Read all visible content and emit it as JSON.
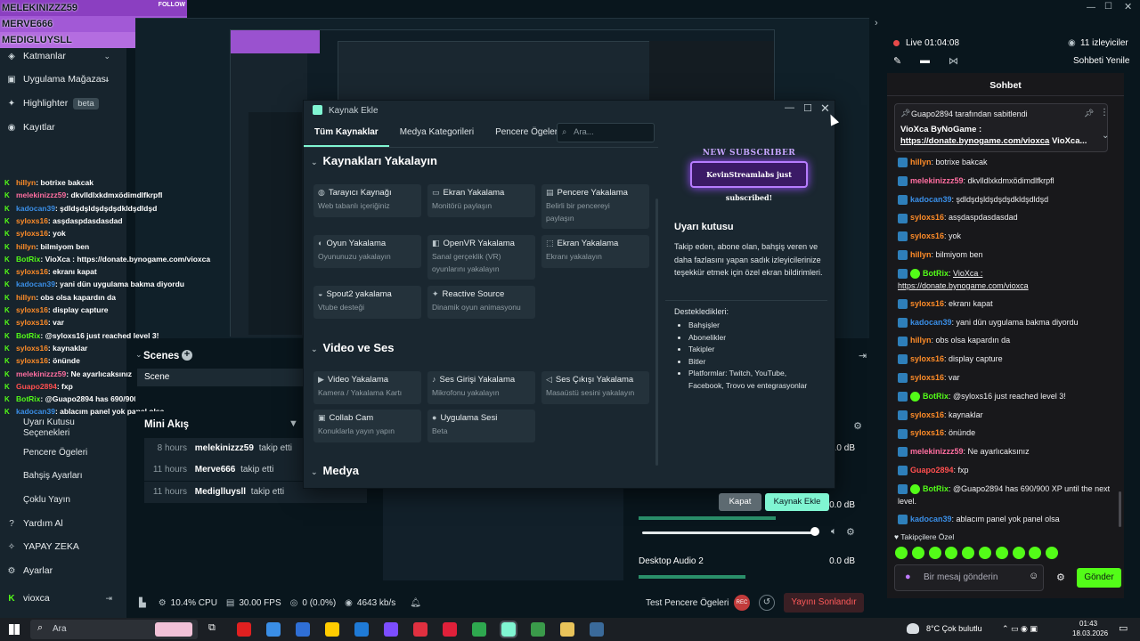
{
  "top_overlay": {
    "names": [
      "MELEKINIZZZ59",
      "MERVE666",
      "MEDIGLUYSLL"
    ],
    "follow": "FOLLOW"
  },
  "sidebar": {
    "items": [
      {
        "label": "Katmanlar",
        "chevron": true
      },
      {
        "label": "Uygulama Mağazası",
        "chevron": true
      },
      {
        "label": "Highlighter",
        "badge": "beta"
      },
      {
        "label": "Kayıtlar"
      }
    ],
    "sub_items": [
      "Uyarı Kutusu Seçenekleri",
      "Pencere Ögeleri",
      "Bahşiş Ayarları",
      "Çoklu Yayın"
    ],
    "bottom": [
      {
        "label": "Yardım Al"
      },
      {
        "label": "YAPAY ZEKA"
      },
      {
        "label": "Ayarlar"
      }
    ],
    "user": "vioxca"
  },
  "overlay_chat": [
    {
      "user": "hillyn",
      "color": "#ff8c28",
      "text": "botrixe bakcak"
    },
    {
      "user": "melekinizzz59",
      "color": "#ff6ea0",
      "text": "dkvlldlxkdmxödimdlfkrpfl"
    },
    {
      "user": "kadocan39",
      "color": "#3a8ee6",
      "text": "şdldşdşldşdşdşdkldşdldşd"
    },
    {
      "user": "syloxs16",
      "color": "#ff8c28",
      "text": "asşdaspdasdasdad"
    },
    {
      "user": "syloxs16",
      "color": "#ff8c28",
      "text": "yok"
    },
    {
      "user": "hillyn",
      "color": "#ff8c28",
      "text": "bilmiyom ben"
    },
    {
      "user": "BotRix",
      "color": "#53fc18",
      "text": "VioXca : https://donate.bynogame.com/vioxca"
    },
    {
      "user": "syloxs16",
      "color": "#ff8c28",
      "text": "ekranı kapat"
    },
    {
      "user": "kadocan39",
      "color": "#3a8ee6",
      "text": "yani dün uygulama bakma diyordu"
    },
    {
      "user": "hillyn",
      "color": "#ff8c28",
      "text": "obs olsa kapardın da"
    },
    {
      "user": "syloxs16",
      "color": "#ff8c28",
      "text": "display capture"
    },
    {
      "user": "syloxs16",
      "color": "#ff8c28",
      "text": "var"
    },
    {
      "user": "BotRix",
      "color": "#53fc18",
      "text": "@syloxs16 just reached level 3!"
    },
    {
      "user": "syloxs16",
      "color": "#ff8c28",
      "text": "kaynaklar"
    },
    {
      "user": "syloxs16",
      "color": "#ff8c28",
      "text": "önünde"
    },
    {
      "user": "melekinizzz59",
      "color": "#ff6ea0",
      "text": "Ne ayarlıcaksınız"
    },
    {
      "user": "Guapo2894",
      "color": "#ff4f4f",
      "text": "fxp"
    },
    {
      "user": "BotRix",
      "color": "#53fc18",
      "text": "@Guapo2894 has 690/900 XP until the next level."
    },
    {
      "user": "kadocan39",
      "color": "#3a8ee6",
      "text": "ablacım panel yok panel olsa"
    }
  ],
  "scenes": {
    "title": "Scenes",
    "items": [
      "Scene"
    ]
  },
  "mini_feed": {
    "title": "Mini Akış",
    "rows": [
      {
        "time": "8 hours",
        "user": "melekinizzz59",
        "action": "takip etti"
      },
      {
        "time": "11 hours",
        "user": "Merve666",
        "action": "takip etti"
      },
      {
        "time": "11 hours",
        "user": "Mediglluysll",
        "action": "takip etti"
      }
    ]
  },
  "mixer": {
    "db1": "0.0 dB",
    "db2": "0.0 dB",
    "desktop_label": "Desktop Audio 2",
    "db3": "0.0 dB"
  },
  "status": {
    "cpu": "10.4% CPU",
    "fps": "30.00 FPS",
    "dropped": "0 (0.0%)",
    "bitrate": "4643 kb/s",
    "test_btn": "Test Pencere Ögeleri",
    "end_btn": "Yayını Sonlandır"
  },
  "dialog": {
    "title": "Kaynak Ekle",
    "tabs": [
      "Tüm Kaynaklar",
      "Medya Kategorileri",
      "Pencere Ögeleri"
    ],
    "search_placeholder": "Ara...",
    "sections": [
      {
        "title": "Kaynakları Yakalayın",
        "cards": [
          {
            "title": "Tarayıcı Kaynağı",
            "desc": "Web tabanlı içeriğiniz"
          },
          {
            "title": "Ekran Yakalama",
            "desc": "Monitörü paylaşın"
          },
          {
            "title": "Pencere Yakalama",
            "desc": "Belirli bir pencereyi paylaşın"
          },
          {
            "title": "Oyun Yakalama",
            "desc": "Oyununuzu yakalayın"
          },
          {
            "title": "OpenVR Yakalama",
            "desc": "Sanal gerçeklik (VR) oyunlarını yakalayın"
          },
          {
            "title": "Ekran Yakalama",
            "desc": "Ekranı yakalayın"
          },
          {
            "title": "Spout2 yakalama",
            "desc": "Vtube desteği"
          },
          {
            "title": "Reactive Source",
            "desc": "Dinamik oyun animasyonu"
          }
        ]
      },
      {
        "title": "Video ve Ses",
        "cards": [
          {
            "title": "Video Yakalama",
            "desc": "Kamera / Yakalama Kartı"
          },
          {
            "title": "Ses Girişi Yakalama",
            "desc": "Mikrofonu yakalayın"
          },
          {
            "title": "Ses Çıkışı Yakalama",
            "desc": "Masaüstü sesini yakalayın"
          },
          {
            "title": "Collab Cam",
            "desc": "Konuklarla yayın yapın"
          },
          {
            "title": "Uygulama Sesi",
            "desc": "Beta"
          }
        ]
      },
      {
        "title": "Medya",
        "cards": []
      }
    ],
    "preview": {
      "banner_top": "NEW SUBSCRIBER",
      "banner_text": "KevinStreamlabs just subscribed!",
      "heading": "Uyarı kutusu",
      "description": "Takip eden, abone olan, bahşiş veren ve daha fazlasını yapan sadık izleyicilerinize teşekkür etmek için özel ekran bildirimleri.",
      "supported_label": "Desteklediklerі:",
      "supported": [
        "Bahşişler",
        "Abonelikler",
        "Takipler",
        "Bitler",
        "Platformlar: Twitch, YouTube, Facebook, Trovo ve entegrasyonlar"
      ]
    },
    "close_btn": "Kapat",
    "add_btn": "Kaynak Ekle"
  },
  "right_panel": {
    "live_time": "Live 01:04:08",
    "viewers": "11 izleyiciler",
    "refresh": "Sohbeti Yenile",
    "chat_title": "Sohbet",
    "pinned_by": "Guapo2894 tarafından sabitlendi",
    "pinned_text": "VioXca ByNoGame :",
    "pinned_link": "https://donate.bynogame.com/vioxca",
    "pinned_suffix": " VioXca...",
    "messages": [
      {
        "user": "hillyn",
        "color": "#ff8c28",
        "text": "botrixe bakcak"
      },
      {
        "user": "melekinizzz59",
        "color": "#ff6ea0",
        "text": "dkvlldlxkdmxödimdlfkrpfl"
      },
      {
        "user": "kadocan39",
        "color": "#3a8ee6",
        "text": "şdldşdşldşdşdşdkldşdldşd"
      },
      {
        "user": "syloxs16",
        "color": "#ff8c28",
        "text": "asşdaspdasdasdad"
      },
      {
        "user": "syloxs16",
        "color": "#ff8c28",
        "text": "yok"
      },
      {
        "user": "hillyn",
        "color": "#ff8c28",
        "text": "bilmiyom ben"
      },
      {
        "user": "BotRix",
        "color": "#53fc18",
        "text": "VioXca : https://donate.bynogame.com/vioxca",
        "bot": true
      },
      {
        "user": "syloxs16",
        "color": "#ff8c28",
        "text": "ekranı kapat"
      },
      {
        "user": "kadocan39",
        "color": "#3a8ee6",
        "text": "yani dün uygulama bakma diyordu"
      },
      {
        "user": "hillyn",
        "color": "#ff8c28",
        "text": "obs olsa kapardın da"
      },
      {
        "user": "syloxs16",
        "color": "#ff8c28",
        "text": "display capture"
      },
      {
        "user": "syloxs16",
        "color": "#ff8c28",
        "text": "var"
      },
      {
        "user": "BotRix",
        "color": "#53fc18",
        "text": "@syloxs16 just reached level 3!",
        "bot": true
      },
      {
        "user": "syloxs16",
        "color": "#ff8c28",
        "text": "kaynaklar"
      },
      {
        "user": "syloxs16",
        "color": "#ff8c28",
        "text": "önünde"
      },
      {
        "user": "melekinizzz59",
        "color": "#ff6ea0",
        "text": "Ne ayarlıcaksınız"
      },
      {
        "user": "Guapo2894",
        "color": "#ff4f4f",
        "text": "fxp"
      },
      {
        "user": "BotRix",
        "color": "#53fc18",
        "text": "@Guapo2894 has 690/900 XP until the next level.",
        "bot": true
      },
      {
        "user": "kadocan39",
        "color": "#3a8ee6",
        "text": "ablacım panel yok panel olsa"
      }
    ],
    "followers_label": "Takipçilere Özel",
    "input_placeholder": "Bir mesaj gönderin",
    "send_btn": "Gönder"
  },
  "taskbar": {
    "search_placeholder": "Ara",
    "weather": "8°C  Çok bulutlu",
    "time": "01:43",
    "date": "18.03.2026"
  },
  "colors": {
    "accent": "#80f5d2",
    "danger": "#e84a4a",
    "kick_green": "#53fc18",
    "chat_bg": "#18181b",
    "panel_bg": "#17242d"
  }
}
